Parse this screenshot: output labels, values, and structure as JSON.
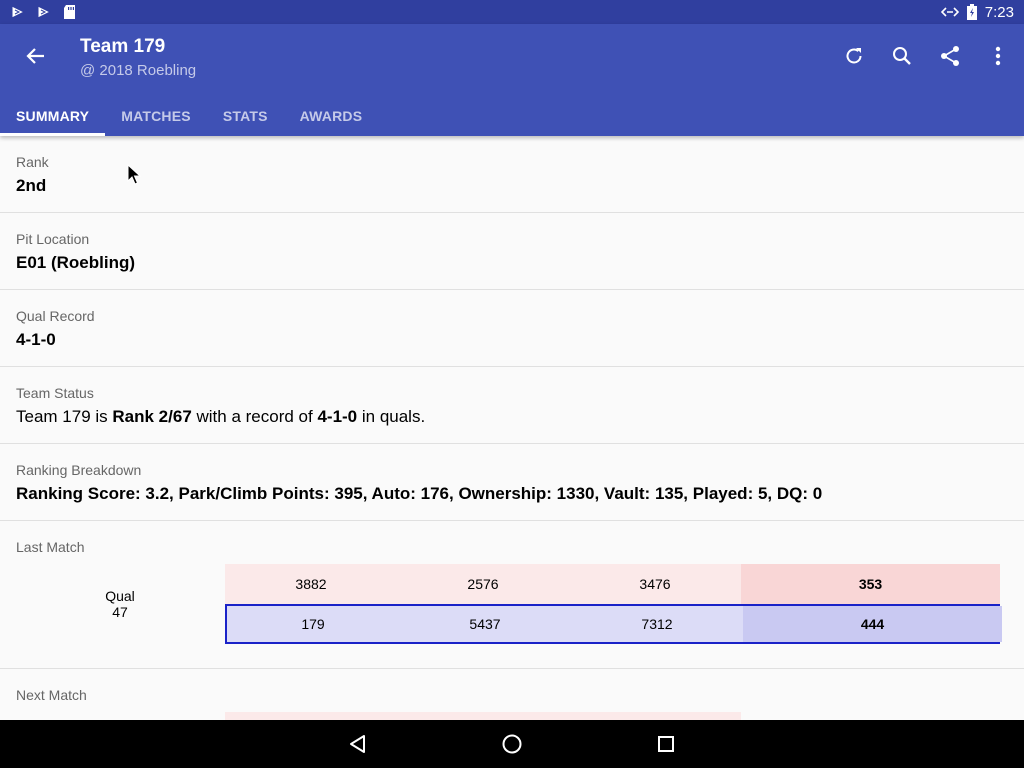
{
  "status_bar": {
    "time": "7:23"
  },
  "app_bar": {
    "title": "Team 179",
    "subtitle": "@ 2018 Roebling",
    "actions": [
      "refresh-icon",
      "search-icon",
      "share-icon",
      "more-vert-icon"
    ]
  },
  "tabs": [
    {
      "label": "SUMMARY",
      "active": true
    },
    {
      "label": "MATCHES",
      "active": false
    },
    {
      "label": "STATS",
      "active": false
    },
    {
      "label": "AWARDS",
      "active": false
    }
  ],
  "summary": {
    "rank": {
      "label": "Rank",
      "value": "2nd"
    },
    "pit_location": {
      "label": "Pit Location",
      "value": "E01 (Roebling)"
    },
    "qual_record": {
      "label": "Qual Record",
      "value": "4-1-0"
    },
    "team_status": {
      "label": "Team Status",
      "text_1": "Team 179 is ",
      "rank_bold": "Rank 2/67",
      "text_2": " with a record of ",
      "record_bold": "4-1-0",
      "text_3": " in quals."
    },
    "ranking_breakdown": {
      "label": "Ranking Breakdown",
      "value": "Ranking Score: 3.2, Park/Climb Points: 395, Auto: 176, Ownership: 1330, Vault: 135, Played: 5, DQ: 0"
    }
  },
  "last_match": {
    "label": "Last Match",
    "match_type": "Qual",
    "match_number": "47",
    "red_alliance": {
      "teams": [
        "3882",
        "2576",
        "3476"
      ],
      "score": "353"
    },
    "blue_alliance": {
      "teams": [
        "179",
        "5437",
        "7312"
      ],
      "score": "444"
    }
  },
  "next_match": {
    "label": "Next Match"
  },
  "colors": {
    "primary": "#3f51b5",
    "primary_dark": "#303f9f",
    "red_alliance_bg": "#fbe9e9",
    "blue_alliance_bg": "#dcdcf7",
    "blue_highlight_border": "#1a22c8"
  }
}
